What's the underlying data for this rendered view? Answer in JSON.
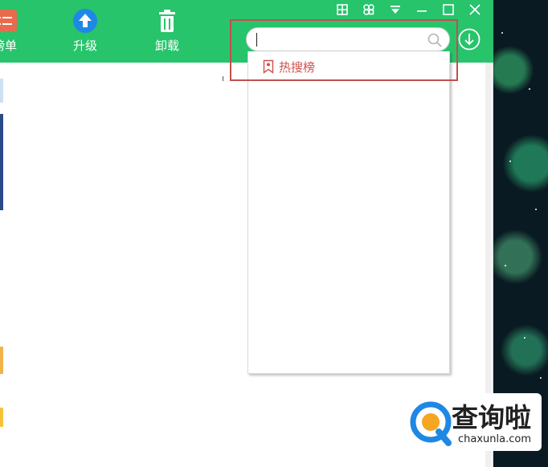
{
  "toolbar": {
    "rank_label": "榜单",
    "upgrade_label": "升级",
    "uninstall_label": "卸载"
  },
  "window_controls": [
    "grid-icon",
    "skin-icon",
    "menu-icon",
    "minimize-icon",
    "maximize-icon",
    "close-icon"
  ],
  "search": {
    "value": "",
    "placeholder": ""
  },
  "dropdown": {
    "items": [
      {
        "icon": "bookmark-icon",
        "label": "热搜榜"
      }
    ]
  },
  "watermark": {
    "text": "查询啦",
    "domain": "chaxunla.com"
  },
  "colors": {
    "brand_green": "#27c46b",
    "highlight_red": "#c0504d",
    "hot_text": "#d0504b",
    "upgrade_blue": "#1e88e5",
    "rank_orange": "#e86b4e"
  }
}
